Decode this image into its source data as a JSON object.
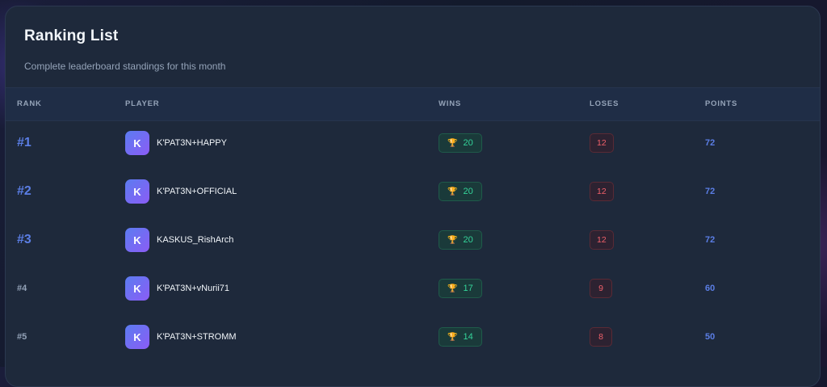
{
  "card": {
    "title": "Ranking List",
    "subtitle": "Complete leaderboard standings for this month"
  },
  "columns": {
    "rank": "RANK",
    "player": "PLAYER",
    "wins": "WINS",
    "loses": "LOSES",
    "points": "POINTS"
  },
  "trophy_icon": "🏆",
  "rows": [
    {
      "rank": "#1",
      "avatar": "K",
      "player": "K'PAT3N+HAPPY",
      "wins": "20",
      "loses": "12",
      "points": "72"
    },
    {
      "rank": "#2",
      "avatar": "K",
      "player": "K'PAT3N+OFFICIAL",
      "wins": "20",
      "loses": "12",
      "points": "72"
    },
    {
      "rank": "#3",
      "avatar": "K",
      "player": "KASKUS_RishArch",
      "wins": "20",
      "loses": "12",
      "points": "72"
    },
    {
      "rank": "#4",
      "avatar": "K",
      "player": "K'PAT3N+vNurii71",
      "wins": "17",
      "loses": "9",
      "points": "60"
    },
    {
      "rank": "#5",
      "avatar": "K",
      "player": "K'PAT3N+STROMM",
      "wins": "14",
      "loses": "8",
      "points": "50"
    }
  ],
  "colors": {
    "accent": "#5b7ee5",
    "wins": "#34d399",
    "loses": "#f0606a"
  }
}
